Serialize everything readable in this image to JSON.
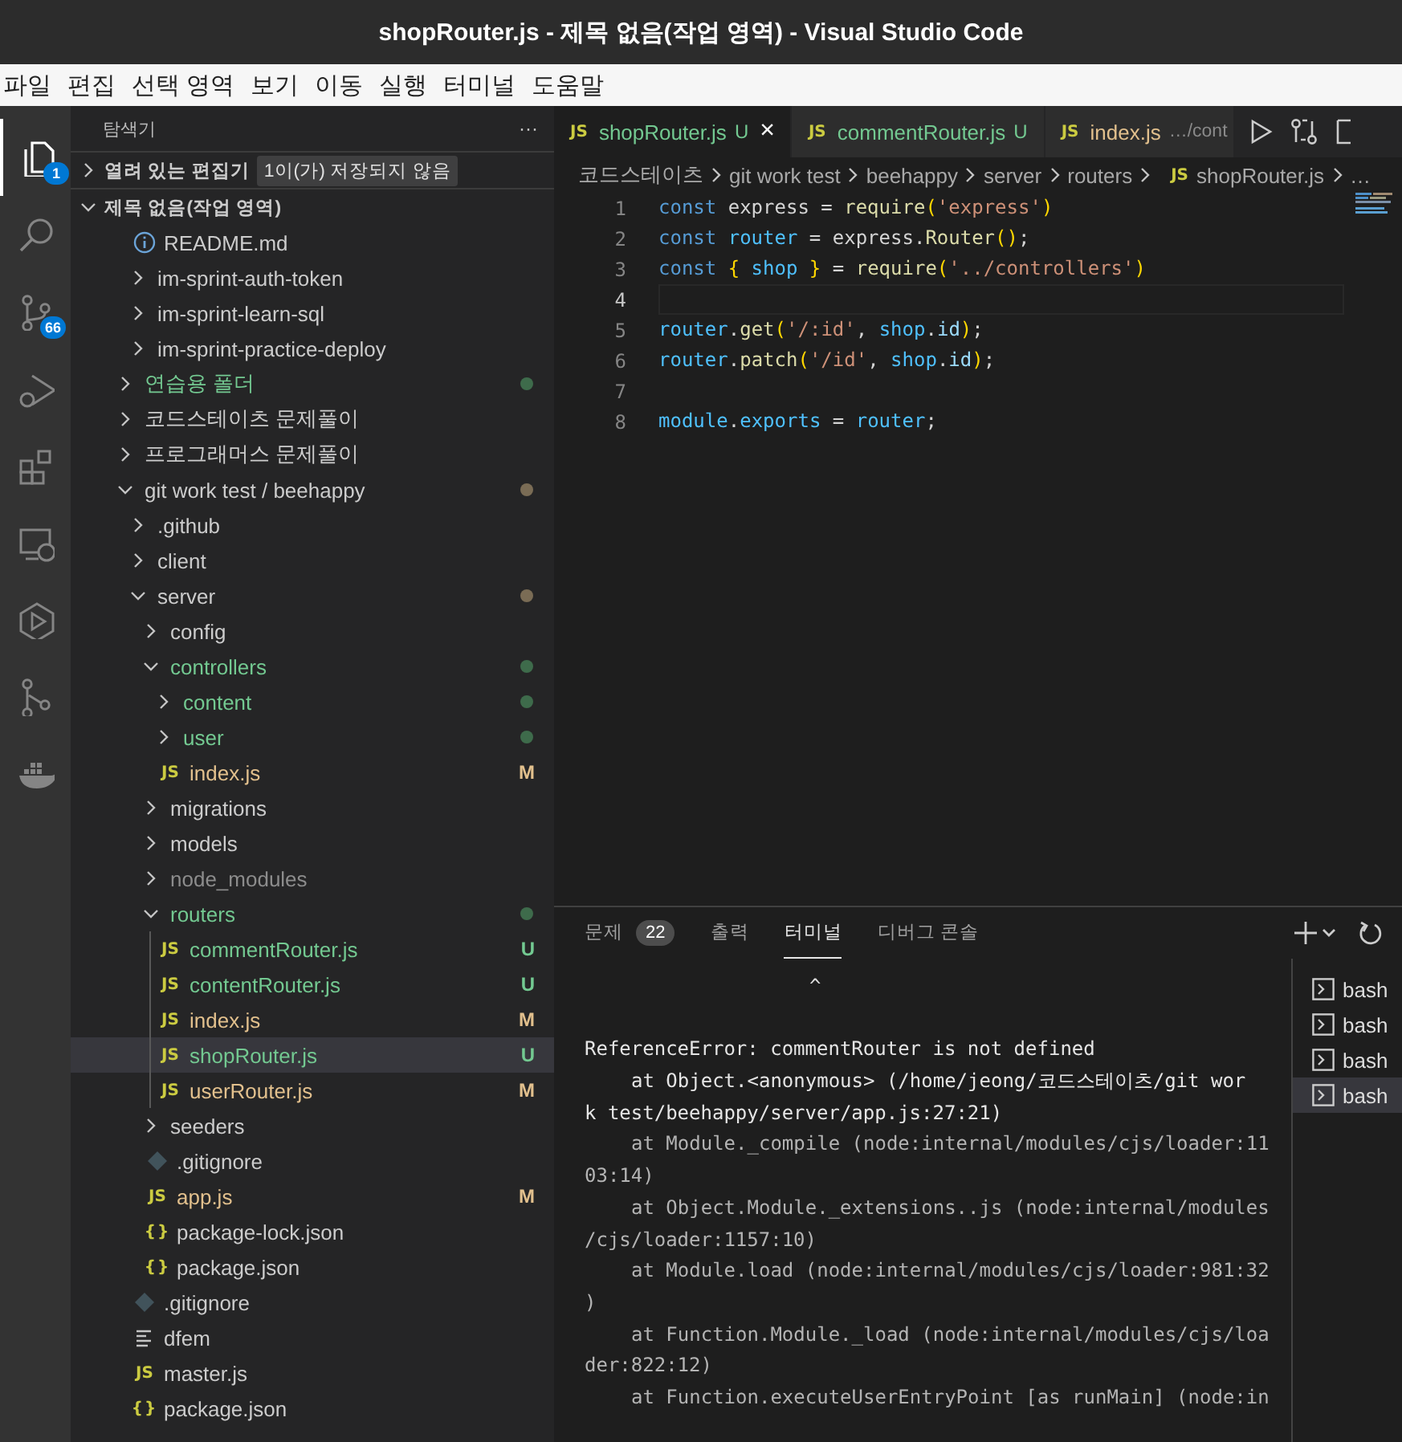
{
  "window": {
    "title": "shopRouter.js - 제목 없음(작업 영역) - Visual Studio Code"
  },
  "menu": [
    "파일",
    "편집",
    "선택 영역",
    "보기",
    "이동",
    "실행",
    "터미널",
    "도움말"
  ],
  "activity_bar": [
    {
      "kind": "files",
      "selected": true,
      "badge": "1"
    },
    {
      "kind": "search",
      "selected": false
    },
    {
      "kind": "source-control",
      "selected": false,
      "badge": "66"
    },
    {
      "kind": "debug",
      "selected": false
    },
    {
      "kind": "extensions",
      "selected": false
    },
    {
      "kind": "remote",
      "selected": false
    },
    {
      "kind": "hexagon",
      "selected": false
    },
    {
      "kind": "graph",
      "selected": false
    },
    {
      "kind": "docker",
      "selected": false
    }
  ],
  "sidebar": {
    "title": "탐색기",
    "more": "···",
    "sections": [
      {
        "label": "열려 있는 편집기",
        "expanded": false,
        "note": "1이(가) 저장되지 않음"
      },
      {
        "label": "제목 없음(작업 영역)",
        "expanded": true
      }
    ],
    "tree": {
      "continued": [
        {
          "label": "README.md",
          "kind": "info",
          "selected": false
        },
        {
          "label": "im-sprint-auth-token",
          "kind": "folder",
          "expanded": false,
          "selected": false
        },
        {
          "label": "im-sprint-learn-sql",
          "kind": "folder",
          "expanded": false,
          "selected": false
        },
        {
          "label": "im-sprint-practice-deploy",
          "kind": "folder",
          "expanded": false,
          "selected": false
        }
      ],
      "items": [
        {
          "label": "연습용 폴더",
          "kind": "folder",
          "expanded": false,
          "untracked": true,
          "dot": true,
          "selected": false
        },
        {
          "label": "코드스테이츠 문제풀이",
          "kind": "folder",
          "expanded": false,
          "selected": false
        },
        {
          "label": "프로그래머스 문제풀이",
          "kind": "folder",
          "expanded": false,
          "selected": false
        },
        {
          "label": "git work test / beehappy",
          "kind": "folder",
          "expanded": true,
          "dot": true,
          "selected": false,
          "children": [
            {
              "label": ".github",
              "kind": "folder",
              "expanded": false,
              "selected": false
            },
            {
              "label": "client",
              "kind": "folder",
              "expanded": false,
              "selected": false
            },
            {
              "label": "server",
              "kind": "folder",
              "expanded": true,
              "dot": true,
              "selected": false,
              "children": [
                {
                  "label": "config",
                  "kind": "folder",
                  "expanded": false,
                  "selected": false
                },
                {
                  "label": "controllers",
                  "kind": "folder",
                  "expanded": true,
                  "untracked": true,
                  "dot": true,
                  "selected": false,
                  "children": [
                    {
                      "label": "content",
                      "kind": "folder",
                      "expanded": false,
                      "untracked": true,
                      "dot": true,
                      "selected": false
                    },
                    {
                      "label": "user",
                      "kind": "folder",
                      "expanded": false,
                      "untracked": true,
                      "dot": true,
                      "selected": false
                    },
                    {
                      "label": "index.js",
                      "kind": "js",
                      "icon_label": "JS",
                      "modified": true,
                      "badge": "M",
                      "selected": false
                    }
                  ]
                },
                {
                  "label": "migrations",
                  "kind": "folder",
                  "expanded": false,
                  "selected": false
                },
                {
                  "label": "models",
                  "kind": "folder",
                  "expanded": false,
                  "selected": false
                },
                {
                  "label": "node_modules",
                  "kind": "folder",
                  "expanded": false,
                  "ignored": true,
                  "selected": false
                },
                {
                  "label": "routers",
                  "kind": "folder",
                  "expanded": true,
                  "untracked": true,
                  "dot": true,
                  "selected": false,
                  "children": [
                    {
                      "label": "commentRouter.js",
                      "kind": "js",
                      "icon_label": "JS",
                      "untracked": true,
                      "badge": "U",
                      "selected": false
                    },
                    {
                      "label": "contentRouter.js",
                      "kind": "js",
                      "icon_label": "JS",
                      "untracked": true,
                      "badge": "U",
                      "selected": false
                    },
                    {
                      "label": "index.js",
                      "kind": "js",
                      "icon_label": "JS",
                      "modified": true,
                      "badge": "M",
                      "selected": false
                    },
                    {
                      "label": "shopRouter.js",
                      "kind": "js",
                      "icon_label": "JS",
                      "untracked": true,
                      "badge": "U",
                      "selected": true
                    },
                    {
                      "label": "userRouter.js",
                      "kind": "js",
                      "icon_label": "JS",
                      "modified": true,
                      "badge": "M",
                      "selected": false
                    }
                  ]
                },
                {
                  "label": "seeders",
                  "kind": "folder",
                  "expanded": false,
                  "selected": false
                },
                {
                  "label": ".gitignore",
                  "kind": "git",
                  "selected": false
                },
                {
                  "label": "app.js",
                  "kind": "js",
                  "icon_label": "JS",
                  "modified": true,
                  "badge": "M",
                  "selected": false
                },
                {
                  "label": "package-lock.json",
                  "kind": "json",
                  "icon_label": "{}",
                  "selected": false
                },
                {
                  "label": "package.json",
                  "kind": "json",
                  "icon_label": "{}",
                  "selected": false
                }
              ]
            },
            {
              "label": ".gitignore",
              "kind": "git",
              "selected": false
            },
            {
              "label": "dfem",
              "kind": "lines",
              "selected": false
            },
            {
              "label": "master.js",
              "kind": "js",
              "icon_label": "JS",
              "selected": false
            },
            {
              "label": "package.json",
              "kind": "json",
              "icon_label": "{}",
              "selected": false
            }
          ]
        }
      ]
    }
  },
  "editor": {
    "tabs": [
      {
        "icon_label": "JS",
        "label": "shopRouter.js",
        "badge": "U",
        "untracked": true,
        "selected": true,
        "close": "×"
      },
      {
        "icon_label": "JS",
        "label": "commentRouter.js",
        "badge": "U",
        "untracked": true,
        "selected": false
      },
      {
        "icon_label": "JS",
        "label": "index.js",
        "description": "…/cont",
        "modified": true,
        "selected": false
      }
    ],
    "breadcrumb": [
      {
        "label": "코드스테이츠"
      },
      {
        "label": "git work test"
      },
      {
        "label": "beehappy"
      },
      {
        "label": "server"
      },
      {
        "label": "routers"
      },
      {
        "label": "shopRouter.js",
        "icon_label": "JS"
      },
      {
        "label": "…"
      }
    ],
    "lines": [
      {
        "number": "1",
        "current": false,
        "tokens": [
          {
            "text": "const",
            "kind": "keyword"
          },
          {
            "text": " express = ",
            "kind": "plain"
          },
          {
            "text": "require",
            "kind": "func"
          },
          {
            "text": "(",
            "kind": "bracket"
          },
          {
            "text": "'express'",
            "kind": "string"
          },
          {
            "text": ")",
            "kind": "bracket"
          }
        ]
      },
      {
        "number": "2",
        "current": false,
        "tokens": [
          {
            "text": "const",
            "kind": "keyword"
          },
          {
            "text": " router",
            "kind": "const"
          },
          {
            "text": " = express.",
            "kind": "plain"
          },
          {
            "text": "Router",
            "kind": "func"
          },
          {
            "text": "()",
            "kind": "bracket"
          },
          {
            "text": ";",
            "kind": "plain"
          }
        ]
      },
      {
        "number": "3",
        "current": false,
        "tokens": [
          {
            "text": "const",
            "kind": "keyword"
          },
          {
            "text": " {",
            "kind": "bracket"
          },
          {
            "text": " shop",
            "kind": "const"
          },
          {
            "text": " }",
            "kind": "bracket"
          },
          {
            "text": " = ",
            "kind": "plain"
          },
          {
            "text": "require",
            "kind": "func"
          },
          {
            "text": "(",
            "kind": "bracket"
          },
          {
            "text": "'../controllers'",
            "kind": "string"
          },
          {
            "text": ")",
            "kind": "bracket"
          }
        ]
      },
      {
        "number": "4",
        "current": true
      },
      {
        "number": "5",
        "current": false,
        "tokens": [
          {
            "text": "router",
            "kind": "const"
          },
          {
            "text": ".",
            "kind": "plain"
          },
          {
            "text": "get",
            "kind": "func"
          },
          {
            "text": "(",
            "kind": "bracket"
          },
          {
            "text": "'/:id'",
            "kind": "string"
          },
          {
            "text": ", ",
            "kind": "plain"
          },
          {
            "text": "shop",
            "kind": "const"
          },
          {
            "text": ".",
            "kind": "plain"
          },
          {
            "text": "id",
            "kind": "prop"
          },
          {
            "text": ")",
            "kind": "bracket"
          },
          {
            "text": ";",
            "kind": "plain"
          }
        ]
      },
      {
        "number": "6",
        "current": false,
        "tokens": [
          {
            "text": "router",
            "kind": "const"
          },
          {
            "text": ".",
            "kind": "plain"
          },
          {
            "text": "patch",
            "kind": "func"
          },
          {
            "text": "(",
            "kind": "bracket"
          },
          {
            "text": "'/id'",
            "kind": "string"
          },
          {
            "text": ", ",
            "kind": "plain"
          },
          {
            "text": "shop",
            "kind": "const"
          },
          {
            "text": ".",
            "kind": "plain"
          },
          {
            "text": "id",
            "kind": "prop"
          },
          {
            "text": ")",
            "kind": "bracket"
          },
          {
            "text": ";",
            "kind": "plain"
          }
        ]
      },
      {
        "number": "7",
        "current": false
      },
      {
        "number": "8",
        "current": false,
        "tokens": [
          {
            "text": "module",
            "kind": "const"
          },
          {
            "text": ".",
            "kind": "plain"
          },
          {
            "text": "exports",
            "kind": "const"
          },
          {
            "text": " = ",
            "kind": "plain"
          },
          {
            "text": "router",
            "kind": "const"
          },
          {
            "text": ";",
            "kind": "plain"
          }
        ]
      }
    ]
  },
  "panel": {
    "tabs": [
      {
        "label": "문제",
        "count": "22",
        "selected": false
      },
      {
        "label": "출력",
        "selected": false
      },
      {
        "label": "터미널",
        "selected": true
      },
      {
        "label": "디버그 콘솔",
        "selected": false
      }
    ],
    "terminal": [
      {
        "text": "^",
        "kind": "caret"
      },
      {
        "kind": "blank"
      },
      {
        "text": "ReferenceError: commentRouter is not defined",
        "kind": "bright"
      },
      {
        "text": "at Object.<anonymous> (/home/jeong/코드스테이츠/git wor",
        "kind": "bright",
        "indent": true
      },
      {
        "text": "k test/beehappy/server/app.js:27:21)",
        "kind": "bright"
      },
      {
        "text": "at Module._compile (node:internal/modules/cjs/loader:11",
        "kind": "dim",
        "indent": true
      },
      {
        "text": "03:14)",
        "kind": "dim"
      },
      {
        "text": "at Object.Module._extensions..js (node:internal/modules",
        "kind": "dim",
        "indent": true
      },
      {
        "text": "/cjs/loader:1157:10)",
        "kind": "dim"
      },
      {
        "text": "at Module.load (node:internal/modules/cjs/loader:981:32",
        "kind": "dim",
        "indent": true
      },
      {
        "text": ")",
        "kind": "dim"
      },
      {
        "text": "at Function.Module._load (node:internal/modules/cjs/loa",
        "kind": "dim",
        "indent": true
      },
      {
        "text": "der:822:12)",
        "kind": "dim"
      },
      {
        "text": "at Function.executeUserEntryPoint [as runMain] (node:in",
        "kind": "dim",
        "indent": true
      }
    ],
    "terminals": [
      {
        "label": "bash",
        "selected": false
      },
      {
        "label": "bash",
        "selected": false
      },
      {
        "label": "bash",
        "selected": false
      },
      {
        "label": "bash",
        "selected": true
      }
    ]
  }
}
